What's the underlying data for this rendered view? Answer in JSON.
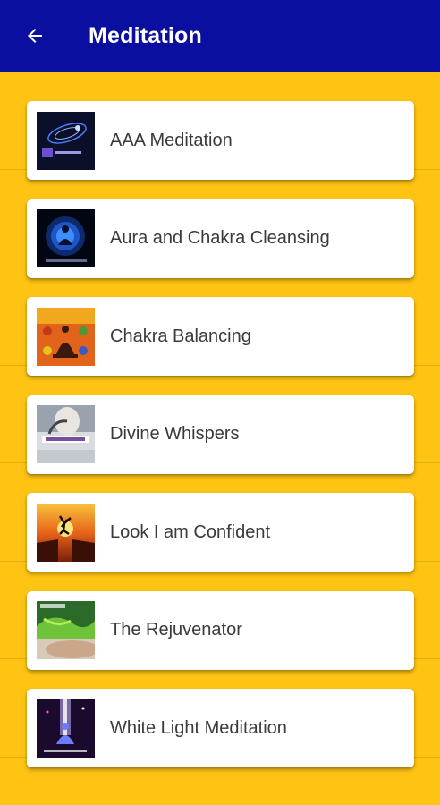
{
  "appbar": {
    "back_icon": "arrow-left-icon",
    "title": "Meditation",
    "background": "#0A0FA0"
  },
  "page": {
    "background": "#FFC413"
  },
  "items": [
    {
      "label": "AAA Meditation",
      "thumb_icon": "aaa-meditation-thumbnail"
    },
    {
      "label": "Aura and Chakra Cleansing",
      "thumb_icon": "aura-chakra-thumbnail"
    },
    {
      "label": "Chakra Balancing",
      "thumb_icon": "chakra-balancing-thumbnail"
    },
    {
      "label": "Divine Whispers",
      "thumb_icon": "divine-whispers-thumbnail"
    },
    {
      "label": "Look I am Confident",
      "thumb_icon": "confident-thumbnail"
    },
    {
      "label": "The Rejuvenator",
      "thumb_icon": "rejuvenator-thumbnail"
    },
    {
      "label": "White Light Meditation",
      "thumb_icon": "white-light-thumbnail"
    }
  ]
}
